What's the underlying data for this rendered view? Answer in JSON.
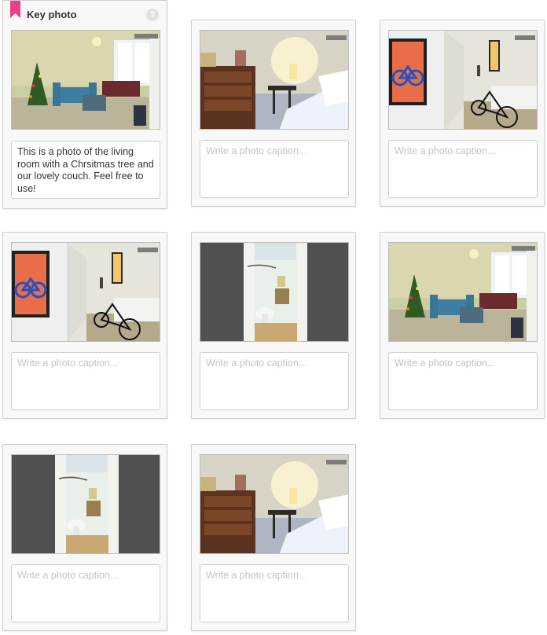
{
  "key_card": {
    "title": "Key photo",
    "help_symbol": "?",
    "caption": "This is a photo of the living room with a Chrsitmas tree and our lovely couch. Feel free to use!"
  },
  "caption_placeholder": "Write a photo caption...",
  "photos": [
    {
      "scene": "living-room",
      "caption": "This is a photo of the living room with a Chrsitmas tree and our lovely couch. Feel free to use!",
      "is_key": true
    },
    {
      "scene": "bedroom",
      "caption": ""
    },
    {
      "scene": "hallway-bike",
      "caption": ""
    },
    {
      "scene": "hallway-bike",
      "caption": ""
    },
    {
      "scene": "bathroom",
      "caption": ""
    },
    {
      "scene": "living-room",
      "caption": ""
    },
    {
      "scene": "bathroom",
      "caption": ""
    },
    {
      "scene": "bedroom",
      "caption": ""
    }
  ],
  "colors": {
    "key_ribbon": "#e83e8c",
    "card_bg": "#f8f8f8",
    "placeholder": "#c4c4c4"
  }
}
